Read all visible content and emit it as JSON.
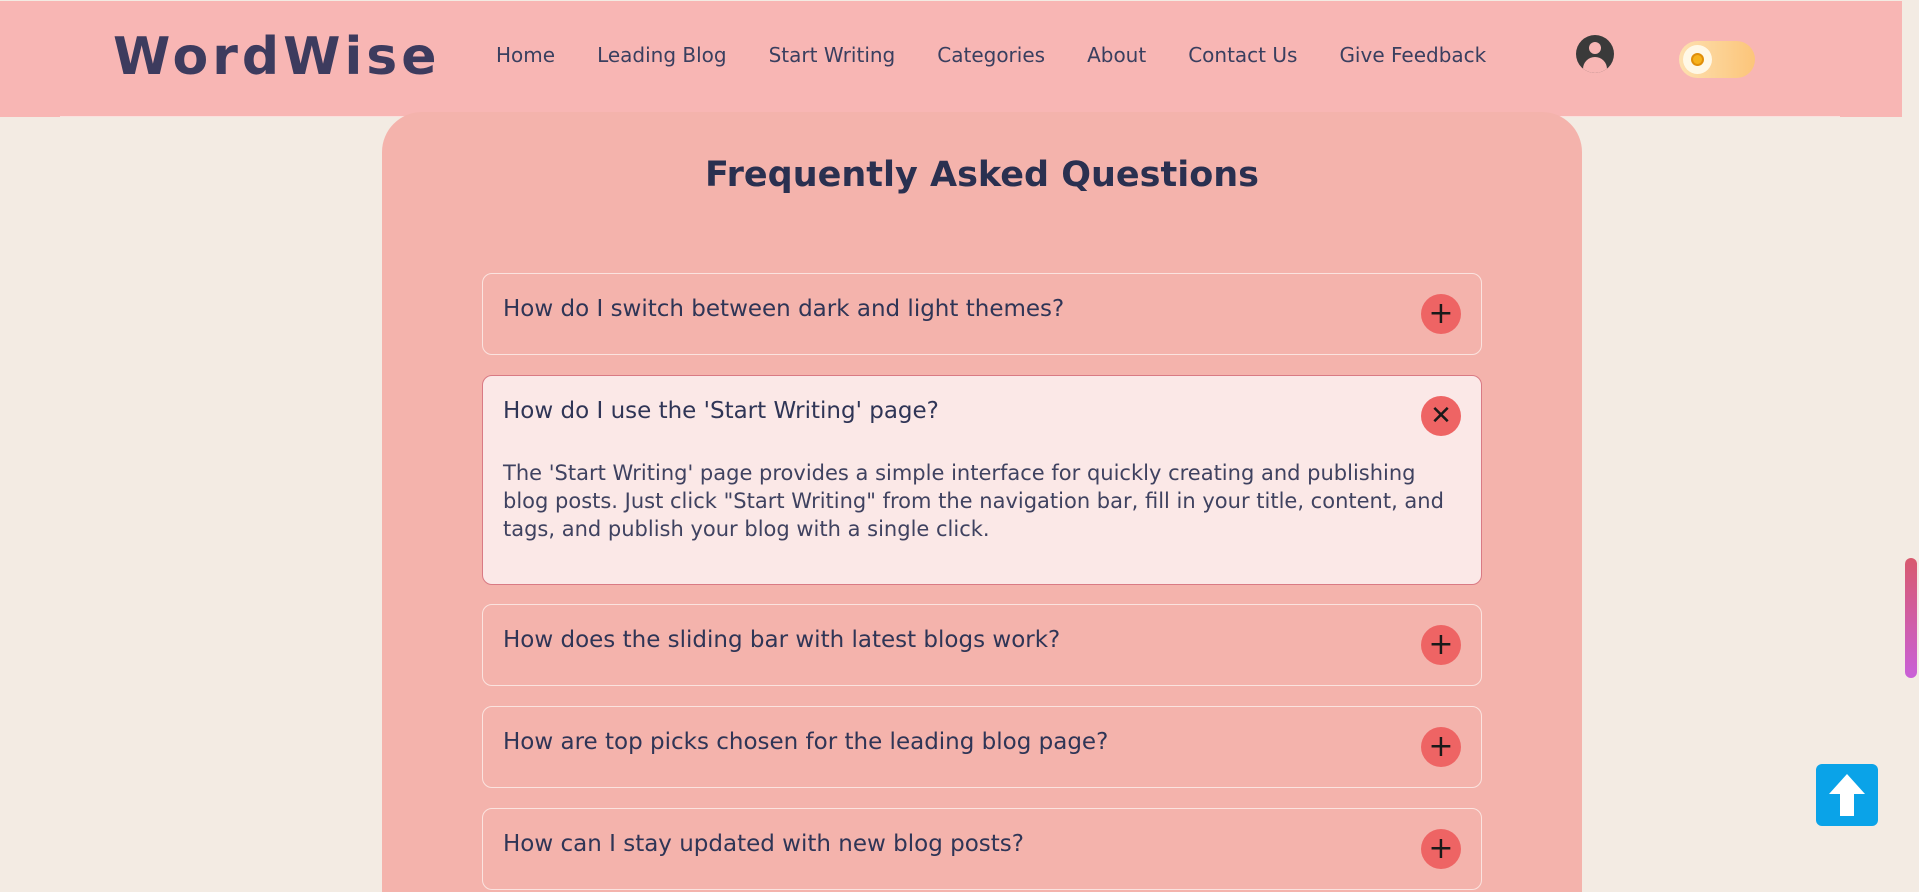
{
  "header": {
    "brand": "WordWise",
    "nav": [
      {
        "label": "Home"
      },
      {
        "label": "Leading Blog"
      },
      {
        "label": "Start Writing"
      },
      {
        "label": "Categories"
      },
      {
        "label": "About"
      },
      {
        "label": "Contact Us"
      },
      {
        "label": "Give Feedback"
      }
    ],
    "user_icon": "user-circle-icon",
    "theme_toggle_icon": "sun-icon",
    "theme": "light"
  },
  "faq": {
    "title": "Frequently Asked Questions",
    "items": [
      {
        "question": "How do I switch between dark and light themes?",
        "open": false,
        "icon": "plus-icon"
      },
      {
        "question": "How do I use the 'Start Writing' page?",
        "open": true,
        "icon": "close-icon",
        "answer": "The 'Start Writing' page provides a simple interface for quickly creating and publishing blog posts. Just click \"Start Writing\" from the navigation bar, fill in your title, content, and tags, and publish your blog with a single click."
      },
      {
        "question": "How does the sliding bar with latest blogs work?",
        "open": false,
        "icon": "plus-icon"
      },
      {
        "question": "How are top picks chosen for the leading blog page?",
        "open": false,
        "icon": "plus-icon"
      },
      {
        "question": "How can I stay updated with new blog posts?",
        "open": false,
        "icon": "plus-icon"
      }
    ]
  },
  "scroll_to_top_icon": "arrow-up-icon",
  "colors": {
    "header_bg": "#f8b6b4",
    "panel_bg": "#f4b3ac",
    "page_bg": "#f3ebe3",
    "accent_button": "#ee6464",
    "scroll_top_button": "#0aa3e8"
  }
}
